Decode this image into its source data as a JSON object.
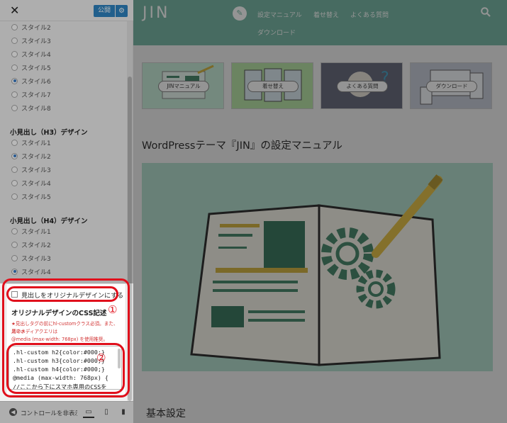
{
  "panel": {
    "close_glyph": "✕",
    "publish_label": "公開",
    "settings_glyph": "⚙",
    "h2_styles": [
      {
        "label": "スタイル2",
        "selected": false
      },
      {
        "label": "スタイル3",
        "selected": false
      },
      {
        "label": "スタイル4",
        "selected": false
      },
      {
        "label": "スタイル5",
        "selected": false
      },
      {
        "label": "スタイル6",
        "selected": true
      },
      {
        "label": "スタイル7",
        "selected": false
      },
      {
        "label": "スタイル8",
        "selected": false
      }
    ],
    "h3_title": "小見出し（H3）デザイン",
    "h3_styles": [
      {
        "label": "スタイル1",
        "selected": false
      },
      {
        "label": "スタイル2",
        "selected": true
      },
      {
        "label": "スタイル3",
        "selected": false
      },
      {
        "label": "スタイル4",
        "selected": false
      },
      {
        "label": "スタイル5",
        "selected": false
      }
    ],
    "h4_title": "小見出し（H4）デザイン",
    "h4_styles": [
      {
        "label": "スタイル1",
        "selected": false
      },
      {
        "label": "スタイル2",
        "selected": false
      },
      {
        "label": "スタイル3",
        "selected": false
      },
      {
        "label": "スタイル4",
        "selected": true
      }
    ],
    "original_checkbox_label": "見出しをオリジナルデザインにする",
    "original_checked": false,
    "css_title": "オリジナルデザインのCSS記述",
    "note_lines": [
      "★見出しタグの前にhl-customクラス必須。また、スマホ",
      "用のメディアクエリは",
      "@media (max-width: 768px) を使用推奨。"
    ],
    "css_code_lines": [
      ".hl-custom h2{color:#000;}",
      ".hl-custom h3{color:#000;}",
      ".hl-custom h4{color:#000;}",
      "@media (max-width: 768px) {",
      "//ここから下にスマホ専用のCSSを"
    ],
    "callout_1": "①",
    "callout_2": "②",
    "footer_control_label": "コントロールを非表示",
    "footer_collapse_glyph": "◀",
    "device_desktop_glyph": "▭",
    "device_tablet_glyph": "▯",
    "device_mobile_glyph": "▮"
  },
  "preview": {
    "logo": "JIN",
    "nav_pencil_glyph": "✎",
    "nav_links": [
      "設定マニュアル",
      "着せ替え",
      "よくある質問",
      "ダウンロード"
    ],
    "search_glyph": "🔍",
    "banners": [
      {
        "label": "JINマニュアル",
        "color": "#c9ecd9"
      },
      {
        "label": "着せ替え",
        "color": "#b9e3a7"
      },
      {
        "label": "よくある質問",
        "color": "#6b6f80"
      },
      {
        "label": "ダウンロード",
        "color": "#c7ccd8"
      }
    ],
    "article_title": "WordPressテーマ『JIN』の設定マニュアル",
    "section_title": "基本設定"
  },
  "colors": {
    "accent": "#7ab9a7",
    "publish": "#2e84c2",
    "callout_red": "#e0101c"
  }
}
